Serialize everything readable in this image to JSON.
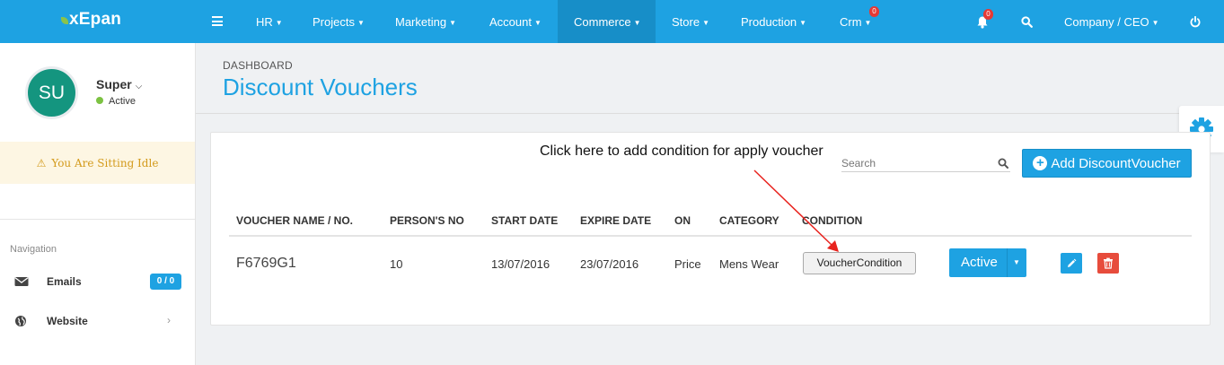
{
  "app": {
    "logo": "xEpan"
  },
  "nav": {
    "items": [
      {
        "label": "HR"
      },
      {
        "label": "Projects"
      },
      {
        "label": "Marketing"
      },
      {
        "label": "Account"
      },
      {
        "label": "Commerce"
      },
      {
        "label": "Store"
      },
      {
        "label": "Production"
      },
      {
        "label": "Crm",
        "badge": "0"
      }
    ],
    "active": "Commerce",
    "notification_badge": "0",
    "user_menu": "Company / CEO"
  },
  "sidebar": {
    "avatar_initials": "SU",
    "user_name": "Super",
    "user_status": "Active",
    "idle_message": "You Are Sitting Idle",
    "navigation_heading": "Navigation",
    "links": [
      {
        "label": "Emails",
        "badge": "0 / 0",
        "icon": "envelope-icon"
      },
      {
        "label": "Website",
        "icon": "globe-icon"
      }
    ]
  },
  "page": {
    "breadcrumb": "DASHBOARD",
    "title": "Discount Vouchers"
  },
  "annotation": {
    "text": "Click here to add condition for apply voucher",
    "arrow_color": "#e8231e"
  },
  "toolbar": {
    "search_placeholder": "Search",
    "add_button": "Add DiscountVoucher"
  },
  "table": {
    "columns": [
      "VOUCHER NAME / NO.",
      "PERSON'S NO",
      "START DATE",
      "EXPIRE DATE",
      "ON",
      "CATEGORY",
      "CONDITION"
    ],
    "rows": [
      {
        "voucher": "F6769G1",
        "persons_no": "10",
        "start_date": "13/07/2016",
        "expire_date": "23/07/2016",
        "on": "Price",
        "category": "Mens Wear",
        "condition_button": "VoucherCondition",
        "status_button": "Active"
      }
    ]
  },
  "colors": {
    "primary": "#1ea2e2",
    "danger": "#e74c3c",
    "avatar": "#14957f",
    "idle_text": "#d39a1b"
  }
}
